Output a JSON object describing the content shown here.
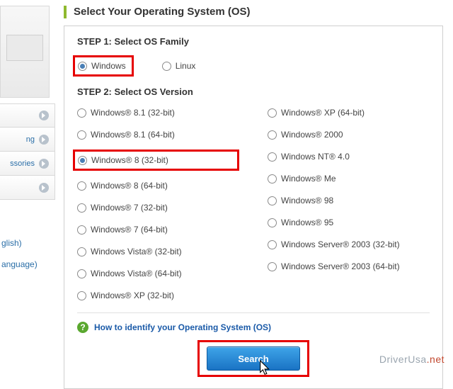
{
  "sidebar": {
    "items": [
      {
        "label": ""
      },
      {
        "label": "ng"
      },
      {
        "label": "ssories"
      },
      {
        "label": ""
      }
    ],
    "lower_items": [
      {
        "label": "glish)"
      },
      {
        "label": "anguage)"
      }
    ]
  },
  "main": {
    "title": "Select Your Operating System (OS)",
    "step1_title": "STEP 1: Select OS Family",
    "os_family": [
      {
        "label": "Windows",
        "checked": true
      },
      {
        "label": "Linux",
        "checked": false
      }
    ],
    "step2_title": "STEP 2: Select OS Version",
    "os_versions_left": [
      {
        "label": "Windows® 8.1 (32-bit)",
        "checked": false
      },
      {
        "label": "Windows® 8.1 (64-bit)",
        "checked": false
      },
      {
        "label": "Windows® 8 (32-bit)",
        "checked": true
      },
      {
        "label": "Windows® 8 (64-bit)",
        "checked": false
      },
      {
        "label": "Windows® 7 (32-bit)",
        "checked": false
      },
      {
        "label": "Windows® 7 (64-bit)",
        "checked": false
      },
      {
        "label": "Windows Vista® (32-bit)",
        "checked": false
      },
      {
        "label": "Windows Vista® (64-bit)",
        "checked": false
      },
      {
        "label": "Windows® XP (32-bit)",
        "checked": false
      }
    ],
    "os_versions_right": [
      {
        "label": "Windows® XP (64-bit)",
        "checked": false
      },
      {
        "label": "Windows® 2000",
        "checked": false
      },
      {
        "label": "Windows NT® 4.0",
        "checked": false
      },
      {
        "label": "Windows® Me",
        "checked": false
      },
      {
        "label": "Windows® 98",
        "checked": false
      },
      {
        "label": "Windows® 95",
        "checked": false
      },
      {
        "label": "Windows Server® 2003 (32-bit)",
        "checked": false
      },
      {
        "label": "Windows Server® 2003 (64-bit)",
        "checked": false
      }
    ],
    "help_text": "How to identify your Operating System (OS)",
    "search_label": "Search"
  },
  "watermark": {
    "text": "DriverUsa",
    "suffix": ".net"
  }
}
